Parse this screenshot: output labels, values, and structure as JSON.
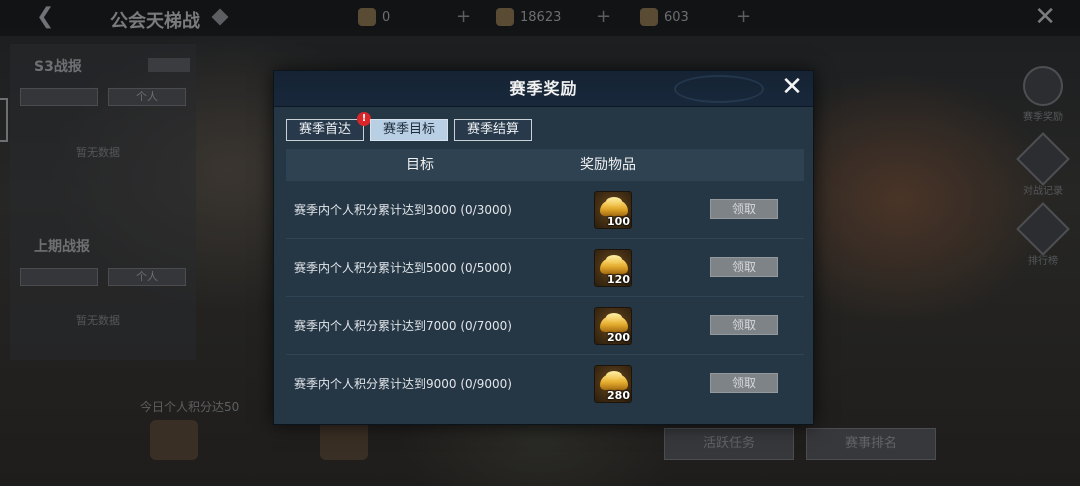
{
  "background": {
    "title": "公会天梯战",
    "resources": [
      {
        "name": "scroll-icon",
        "value": "0"
      },
      {
        "name": "ingot-icon",
        "value": "18623"
      },
      {
        "name": "coin-icon",
        "value": "603"
      }
    ],
    "left_panel": {
      "section1_title": "S3战报",
      "section1_tab_right": "个人",
      "section1_empty": "暂无数据",
      "section2_title": "上期战报",
      "section2_tab_right": "个人",
      "section2_empty": "暂无数据"
    },
    "right_icons": [
      "赛季奖励",
      "对战记录",
      "排行榜"
    ],
    "bottom_text": "今日个人积分达50",
    "bottom_buttons": [
      "活跃任务",
      "赛事排名"
    ]
  },
  "modal": {
    "title": "赛季奖励",
    "tabs": [
      {
        "label": "赛季首达",
        "alert": "!"
      },
      {
        "label": "赛季目标"
      },
      {
        "label": "赛季结算"
      }
    ],
    "active_tab": 1,
    "columns": {
      "goal": "目标",
      "reward": "奖励物品"
    },
    "rows": [
      {
        "goal": "赛季内个人积分累计达到3000 (0/3000)",
        "reward_icon": "gold-ingot-icon",
        "reward_qty": "100",
        "button": "领取"
      },
      {
        "goal": "赛季内个人积分累计达到5000 (0/5000)",
        "reward_icon": "gold-ingot-icon",
        "reward_qty": "120",
        "button": "领取"
      },
      {
        "goal": "赛季内个人积分累计达到7000 (0/7000)",
        "reward_icon": "gold-ingot-icon",
        "reward_qty": "200",
        "button": "领取"
      },
      {
        "goal": "赛季内个人积分累计达到9000 (0/9000)",
        "reward_icon": "gold-ingot-icon",
        "reward_qty": "280",
        "button": "领取"
      }
    ],
    "colors": {
      "panel_bg": "#253645",
      "header_bg": "#152334",
      "active_tab_bg": "#b8cfe4",
      "claim_disabled": "#7e8387",
      "alert_red": "#d8262b"
    }
  }
}
